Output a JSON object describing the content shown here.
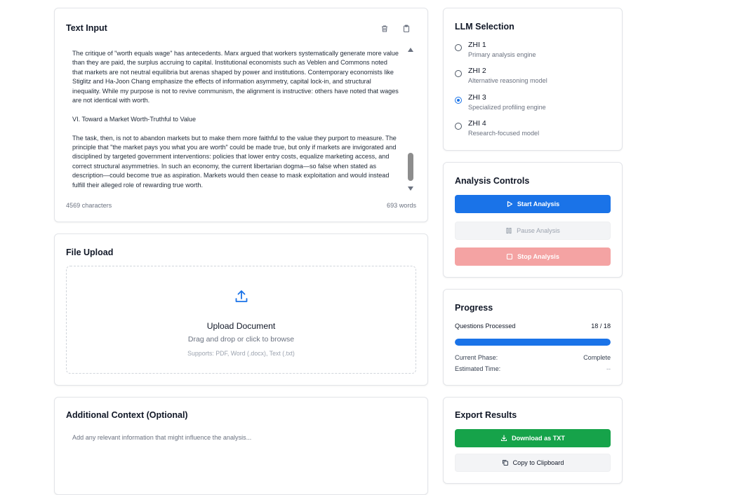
{
  "text_input": {
    "title": "Text Input",
    "paragraphs": [
      "The critique of \"worth equals wage\" has antecedents. Marx argued that workers systematically generate more value than they are paid, the surplus accruing to capital. Institutional economists such as Veblen and Commons noted that markets are not neutral equilibria but arenas shaped by power and institutions. Contemporary economists like Stiglitz and Ha-Joon Chang emphasize the effects of information asymmetry, capital lock-in, and structural inequality. While my purpose is not to revive communism, the alignment is instructive: others have noted that wages are not identical with worth.",
      "VI. Toward a Market Worth-Truthful to Value",
      "The task, then, is not to abandon markets but to make them more faithful to the value they purport to measure. The principle that \"the market pays you what you are worth\" could be made true, but only if markets are invigorated and disciplined by targeted government interventions: policies that lower entry costs, equalize marketing access, and correct structural asymmetries. In such an economy, the current libertarian dogma—so false when stated as description—could become true as aspiration. Markets would then cease to mask exploitation and would instead fulfill their alleged role of rewarding true worth."
    ],
    "char_count": "4569 characters",
    "word_count": "693 words",
    "icons": {
      "delete": "trash-icon",
      "copy": "clipboard-icon"
    }
  },
  "file_upload": {
    "title": "File Upload",
    "heading": "Upload Document",
    "subtext": "Drag and drop or click to browse",
    "supports": "Supports: PDF, Word (.docx), Text (.txt)",
    "icon": "upload-icon"
  },
  "additional_context": {
    "title": "Additional Context (Optional)",
    "placeholder": "Add any relevant information that might influence the analysis...",
    "value": ""
  },
  "llm_selection": {
    "title": "LLM Selection",
    "options": [
      {
        "label": "ZHI 1",
        "description": "Primary analysis engine",
        "checked": false
      },
      {
        "label": "ZHI 2",
        "description": "Alternative reasoning model",
        "checked": false
      },
      {
        "label": "ZHI 3",
        "description": "Specialized profiling engine",
        "checked": true
      },
      {
        "label": "ZHI 4",
        "description": "Research-focused model",
        "checked": false
      }
    ]
  },
  "analysis_controls": {
    "title": "Analysis Controls",
    "start_label": "Start Analysis",
    "pause_label": "Pause Analysis",
    "stop_label": "Stop Analysis"
  },
  "progress": {
    "title": "Progress",
    "questions_label": "Questions Processed",
    "questions_count": "18 / 18",
    "fraction": 1.0,
    "phase_label": "Current Phase:",
    "phase_value": "Complete",
    "time_label": "Estimated Time:",
    "time_value": "--"
  },
  "export": {
    "title": "Export Results",
    "download_label": "Download as TXT",
    "copy_label": "Copy to Clipboard"
  },
  "colors": {
    "primary": "#1a73e8",
    "success": "#16a34a",
    "danger_disabled": "#f4a3a3"
  }
}
